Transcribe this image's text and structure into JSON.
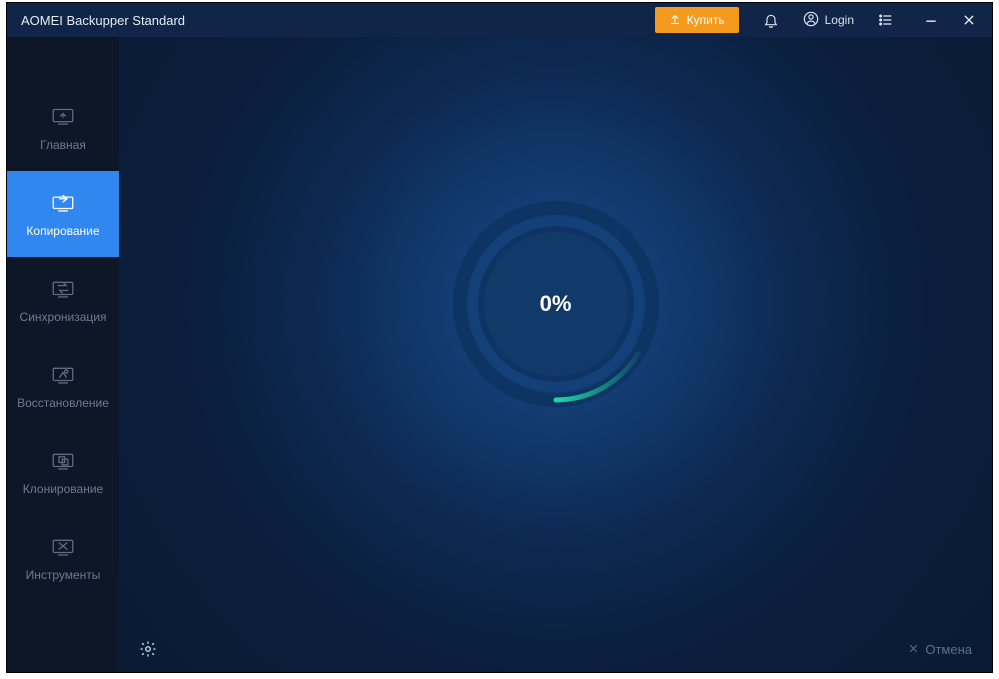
{
  "header": {
    "title": "AOMEI Backupper Standard",
    "buy_label": "Купить",
    "login_label": "Login"
  },
  "sidebar": {
    "items": [
      {
        "label": "Главная"
      },
      {
        "label": "Копирование"
      },
      {
        "label": "Синхронизация"
      },
      {
        "label": "Восстановление"
      },
      {
        "label": "Клонирование"
      },
      {
        "label": "Инструменты"
      }
    ],
    "active_index": 1
  },
  "progress": {
    "percent_label": "0%",
    "percent_value": 0
  },
  "footer": {
    "cancel_label": "Отмена"
  }
}
